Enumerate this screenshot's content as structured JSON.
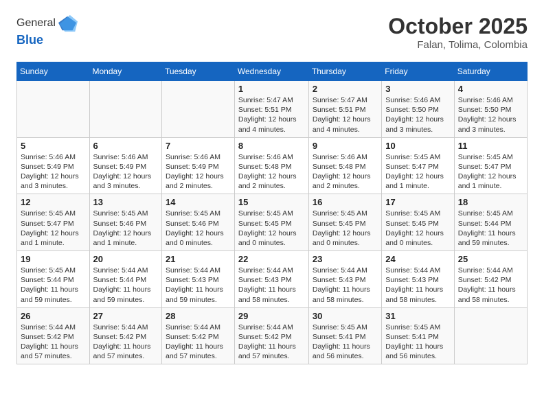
{
  "header": {
    "logo_general": "General",
    "logo_blue": "Blue",
    "title": "October 2025",
    "subtitle": "Falan, Tolima, Colombia"
  },
  "weekdays": [
    "Sunday",
    "Monday",
    "Tuesday",
    "Wednesday",
    "Thursday",
    "Friday",
    "Saturday"
  ],
  "weeks": [
    [
      {
        "day": "",
        "info": ""
      },
      {
        "day": "",
        "info": ""
      },
      {
        "day": "",
        "info": ""
      },
      {
        "day": "1",
        "info": "Sunrise: 5:47 AM\nSunset: 5:51 PM\nDaylight: 12 hours and 4 minutes."
      },
      {
        "day": "2",
        "info": "Sunrise: 5:47 AM\nSunset: 5:51 PM\nDaylight: 12 hours and 4 minutes."
      },
      {
        "day": "3",
        "info": "Sunrise: 5:46 AM\nSunset: 5:50 PM\nDaylight: 12 hours and 3 minutes."
      },
      {
        "day": "4",
        "info": "Sunrise: 5:46 AM\nSunset: 5:50 PM\nDaylight: 12 hours and 3 minutes."
      }
    ],
    [
      {
        "day": "5",
        "info": "Sunrise: 5:46 AM\nSunset: 5:49 PM\nDaylight: 12 hours and 3 minutes."
      },
      {
        "day": "6",
        "info": "Sunrise: 5:46 AM\nSunset: 5:49 PM\nDaylight: 12 hours and 3 minutes."
      },
      {
        "day": "7",
        "info": "Sunrise: 5:46 AM\nSunset: 5:49 PM\nDaylight: 12 hours and 2 minutes."
      },
      {
        "day": "8",
        "info": "Sunrise: 5:46 AM\nSunset: 5:48 PM\nDaylight: 12 hours and 2 minutes."
      },
      {
        "day": "9",
        "info": "Sunrise: 5:46 AM\nSunset: 5:48 PM\nDaylight: 12 hours and 2 minutes."
      },
      {
        "day": "10",
        "info": "Sunrise: 5:45 AM\nSunset: 5:47 PM\nDaylight: 12 hours and 1 minute."
      },
      {
        "day": "11",
        "info": "Sunrise: 5:45 AM\nSunset: 5:47 PM\nDaylight: 12 hours and 1 minute."
      }
    ],
    [
      {
        "day": "12",
        "info": "Sunrise: 5:45 AM\nSunset: 5:47 PM\nDaylight: 12 hours and 1 minute."
      },
      {
        "day": "13",
        "info": "Sunrise: 5:45 AM\nSunset: 5:46 PM\nDaylight: 12 hours and 1 minute."
      },
      {
        "day": "14",
        "info": "Sunrise: 5:45 AM\nSunset: 5:46 PM\nDaylight: 12 hours and 0 minutes."
      },
      {
        "day": "15",
        "info": "Sunrise: 5:45 AM\nSunset: 5:45 PM\nDaylight: 12 hours and 0 minutes."
      },
      {
        "day": "16",
        "info": "Sunrise: 5:45 AM\nSunset: 5:45 PM\nDaylight: 12 hours and 0 minutes."
      },
      {
        "day": "17",
        "info": "Sunrise: 5:45 AM\nSunset: 5:45 PM\nDaylight: 12 hours and 0 minutes."
      },
      {
        "day": "18",
        "info": "Sunrise: 5:45 AM\nSunset: 5:44 PM\nDaylight: 11 hours and 59 minutes."
      }
    ],
    [
      {
        "day": "19",
        "info": "Sunrise: 5:45 AM\nSunset: 5:44 PM\nDaylight: 11 hours and 59 minutes."
      },
      {
        "day": "20",
        "info": "Sunrise: 5:44 AM\nSunset: 5:44 PM\nDaylight: 11 hours and 59 minutes."
      },
      {
        "day": "21",
        "info": "Sunrise: 5:44 AM\nSunset: 5:43 PM\nDaylight: 11 hours and 59 minutes."
      },
      {
        "day": "22",
        "info": "Sunrise: 5:44 AM\nSunset: 5:43 PM\nDaylight: 11 hours and 58 minutes."
      },
      {
        "day": "23",
        "info": "Sunrise: 5:44 AM\nSunset: 5:43 PM\nDaylight: 11 hours and 58 minutes."
      },
      {
        "day": "24",
        "info": "Sunrise: 5:44 AM\nSunset: 5:43 PM\nDaylight: 11 hours and 58 minutes."
      },
      {
        "day": "25",
        "info": "Sunrise: 5:44 AM\nSunset: 5:42 PM\nDaylight: 11 hours and 58 minutes."
      }
    ],
    [
      {
        "day": "26",
        "info": "Sunrise: 5:44 AM\nSunset: 5:42 PM\nDaylight: 11 hours and 57 minutes."
      },
      {
        "day": "27",
        "info": "Sunrise: 5:44 AM\nSunset: 5:42 PM\nDaylight: 11 hours and 57 minutes."
      },
      {
        "day": "28",
        "info": "Sunrise: 5:44 AM\nSunset: 5:42 PM\nDaylight: 11 hours and 57 minutes."
      },
      {
        "day": "29",
        "info": "Sunrise: 5:44 AM\nSunset: 5:42 PM\nDaylight: 11 hours and 57 minutes."
      },
      {
        "day": "30",
        "info": "Sunrise: 5:45 AM\nSunset: 5:41 PM\nDaylight: 11 hours and 56 minutes."
      },
      {
        "day": "31",
        "info": "Sunrise: 5:45 AM\nSunset: 5:41 PM\nDaylight: 11 hours and 56 minutes."
      },
      {
        "day": "",
        "info": ""
      }
    ]
  ]
}
